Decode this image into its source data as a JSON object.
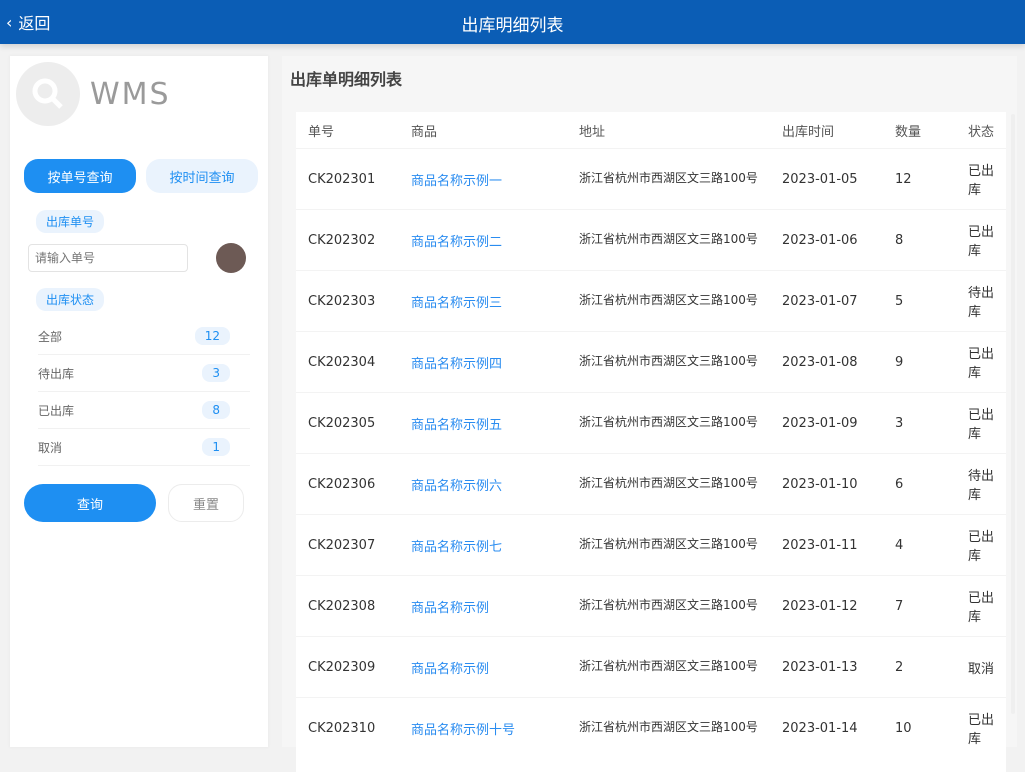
{
  "header": {
    "back_icon": "chevron-left-icon",
    "back_label": "返回",
    "title": "出库明细列表"
  },
  "sidebar": {
    "logo_text": "WMS",
    "tab_primary": "按单号查询",
    "tab_secondary": "按时间查询",
    "filter_tag_1": "出库单号",
    "search_placeholder": "请输入单号",
    "filter_tag_2": "出库状态",
    "rows": [
      {
        "label": "全部",
        "value": "12"
      },
      {
        "label": "待出库",
        "value": "3"
      },
      {
        "label": "已出库",
        "value": "8"
      },
      {
        "label": "取消",
        "value": "1"
      }
    ],
    "search_button": "查询",
    "reset_button": "重置"
  },
  "main": {
    "section_title": "出库单明细列表",
    "columns": [
      "单号",
      "商品",
      "地址",
      "出库时间",
      "数量",
      "状态"
    ],
    "rows": [
      {
        "code": "CK202301",
        "item": "商品名称示例一",
        "addr": "浙江省杭州市西湖区文三路100号",
        "date": "2023-01-05",
        "qty": "12",
        "status": "已出库"
      },
      {
        "code": "CK202302",
        "item": "商品名称示例二",
        "addr": "浙江省杭州市西湖区文三路100号",
        "date": "2023-01-06",
        "qty": "8",
        "status": "已出库"
      },
      {
        "code": "CK202303",
        "item": "商品名称示例三",
        "addr": "浙江省杭州市西湖区文三路100号",
        "date": "2023-01-07",
        "qty": "5",
        "status": "待出库"
      },
      {
        "code": "CK202304",
        "item": "商品名称示例四",
        "addr": "浙江省杭州市西湖区文三路100号",
        "date": "2023-01-08",
        "qty": "9",
        "status": "已出库"
      },
      {
        "code": "CK202305",
        "item": "商品名称示例五",
        "addr": "浙江省杭州市西湖区文三路100号",
        "date": "2023-01-09",
        "qty": "3",
        "status": "已出库"
      },
      {
        "code": "CK202306",
        "item": "商品名称示例六",
        "addr": "浙江省杭州市西湖区文三路100号",
        "date": "2023-01-10",
        "qty": "6",
        "status": "待出库"
      },
      {
        "code": "CK202307",
        "item": "商品名称示例七",
        "addr": "浙江省杭州市西湖区文三路100号",
        "date": "2023-01-11",
        "qty": "4",
        "status": "已出库"
      },
      {
        "code": "CK202308",
        "item": "商品名称示例",
        "addr": "浙江省杭州市西湖区文三路100号",
        "date": "2023-01-12",
        "qty": "7",
        "status": "已出库"
      },
      {
        "code": "CK202309",
        "item": "商品名称示例",
        "addr": "浙江省杭州市西湖区文三路100号",
        "date": "2023-01-13",
        "qty": "2",
        "status": "取消"
      },
      {
        "code": "CK202310",
        "item": "商品名称示例十号",
        "addr": "浙江省杭州市西湖区文三路100号",
        "date": "2023-01-14",
        "qty": "10",
        "status": "已出库"
      }
    ]
  },
  "colors": {
    "header_bg": "#0b5db5",
    "accent": "#1e8ff2",
    "link": "#2a8cf0"
  }
}
